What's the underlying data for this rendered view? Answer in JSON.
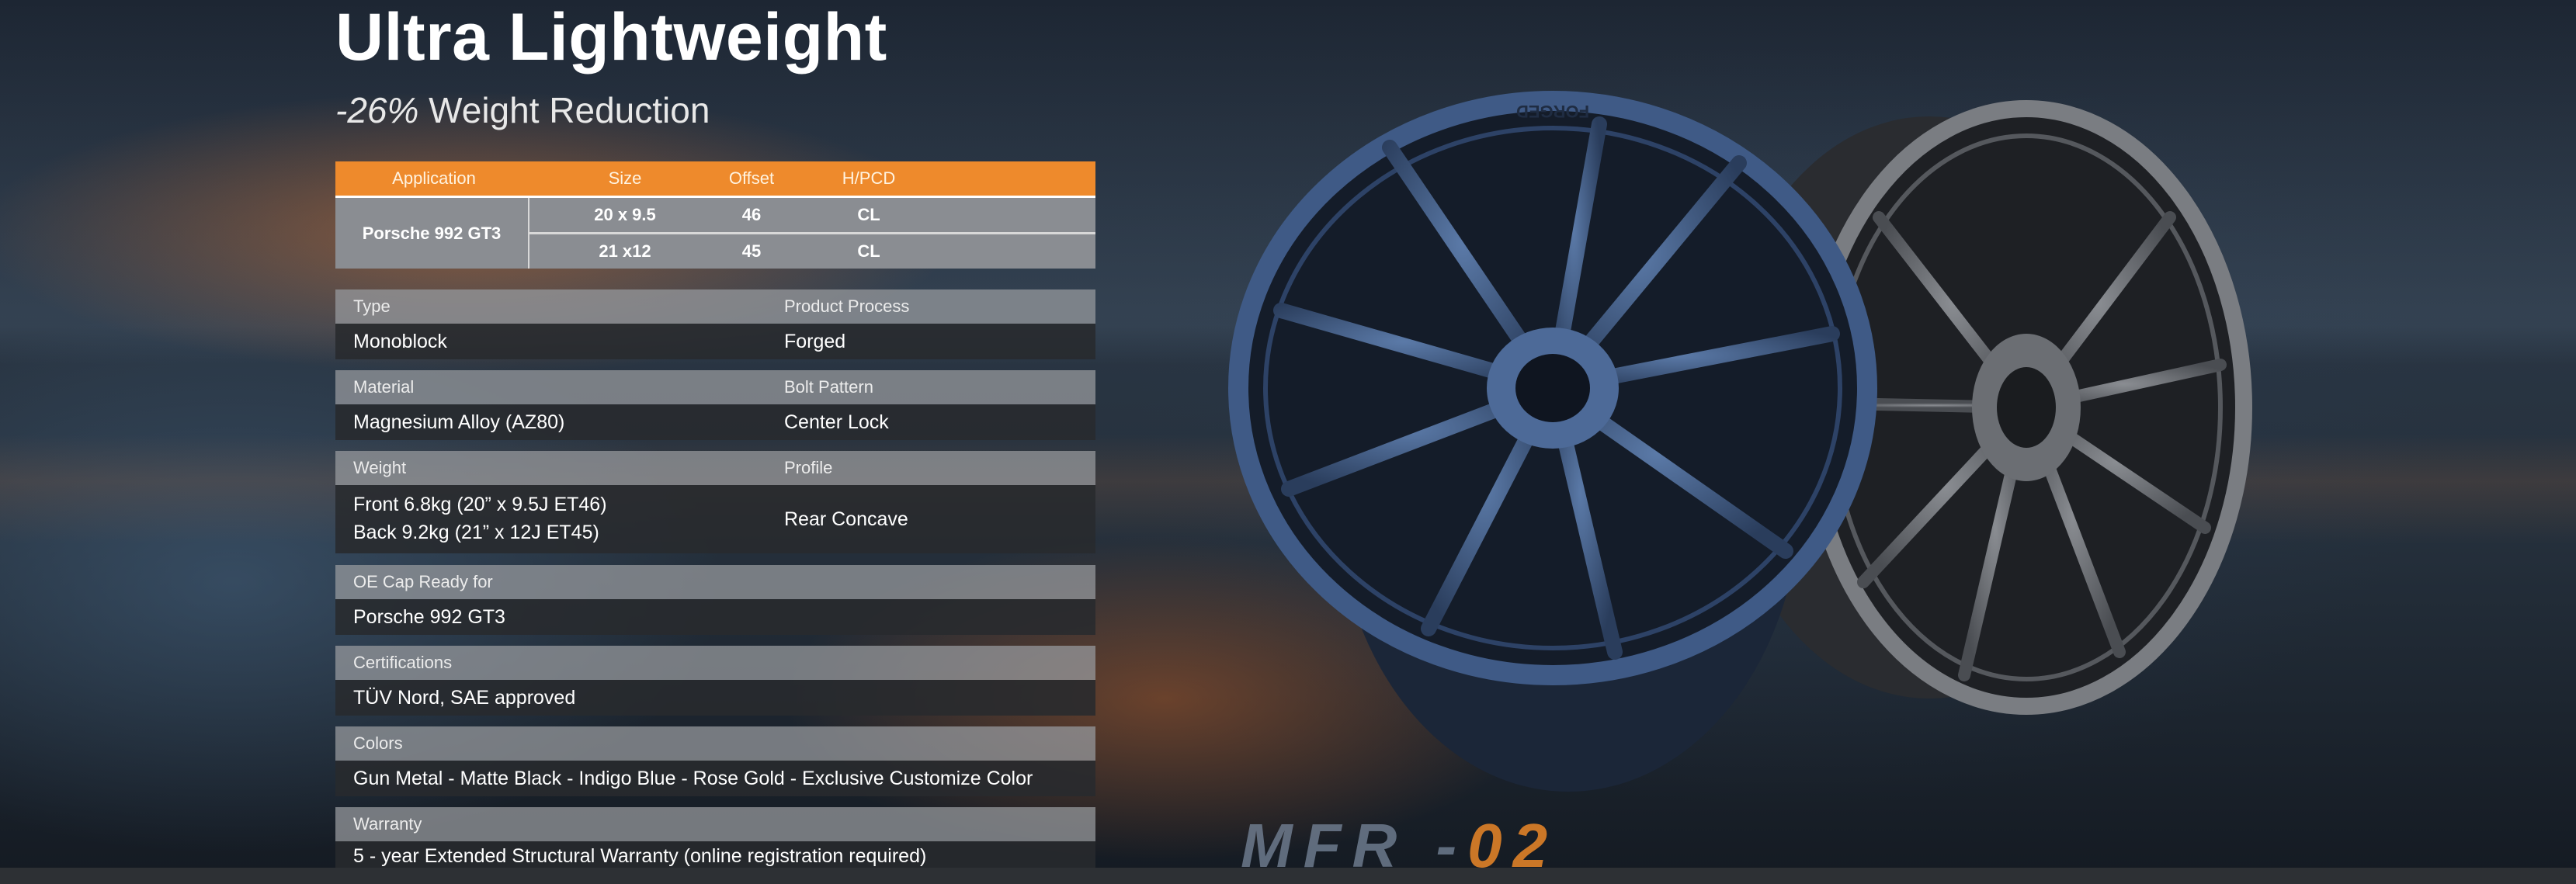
{
  "page": {
    "title": "Ultra Lightweight",
    "subtitle_pct": "-26%",
    "subtitle_text": " Weight Reduction"
  },
  "application_table": {
    "headers": [
      "Application",
      "Size",
      "Offset",
      "H/PCD"
    ],
    "model": "Porsche 992 GT3",
    "rows": [
      {
        "size": "20 x 9.5",
        "offset": "46",
        "hpcd": "CL"
      },
      {
        "size": "21 x12",
        "offset": "45",
        "hpcd": "CL"
      }
    ]
  },
  "specs": {
    "type_label": "Type",
    "type_value": "Monoblock",
    "process_label": "Product Process",
    "process_value": "Forged",
    "material_label": "Material",
    "material_value": "Magnesium Alloy (AZ80)",
    "bolt_label": "Bolt Pattern",
    "bolt_value": "Center Lock",
    "weight_label": "Weight",
    "weight_front": "Front 6.8kg (20” x 9.5J ET46)",
    "weight_back": "Back 9.2kg (21” x 12J ET45)",
    "profile_label": "Profile",
    "profile_value": "Rear Concave",
    "oecap_label": "OE Cap Ready for",
    "oecap_value": "Porsche 992 GT3",
    "cert_label": "Certifications",
    "cert_value": "TÜV Nord, SAE approved",
    "colors_label": "Colors",
    "colors_value": "Gun Metal - Matte Black - Indigo Blue - Rose Gold - Exclusive Customize Color",
    "warranty_label": "Warranty",
    "warranty_value": "5 - year Extended Structural Warranty (online registration required)"
  },
  "wheel_stamp": "FORGED",
  "brand": {
    "part1": "MFR -",
    "part2": "02"
  },
  "colors": {
    "accent_orange": "#ee8a2c",
    "blue_wheel": "#3f5a86",
    "gray_wheel": "#6e7176"
  }
}
